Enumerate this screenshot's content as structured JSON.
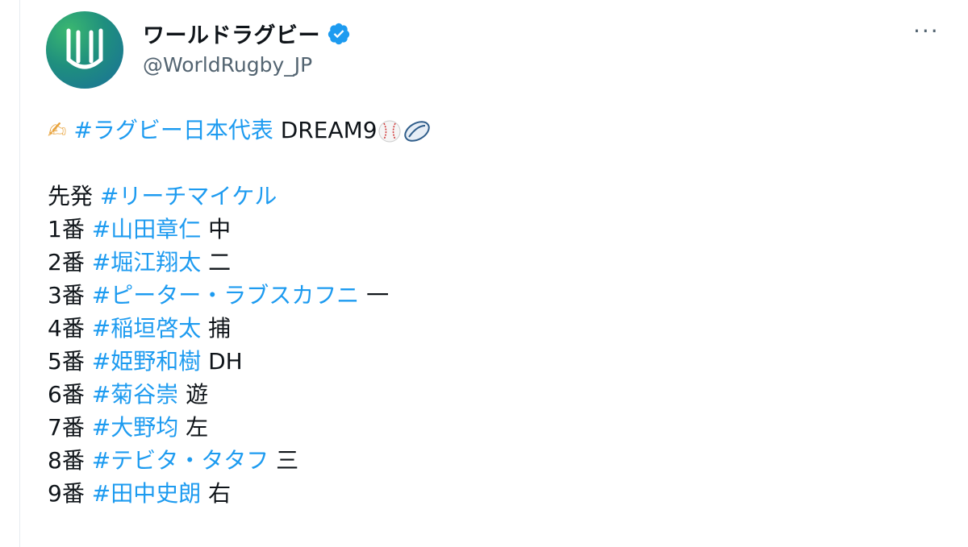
{
  "account": {
    "display_name": "ワールドラグビー",
    "handle": "@WorldRugby_JP",
    "verified_icon": "verified-badge-icon",
    "more_icon": "more-icon",
    "more_label": "···",
    "brand_color": "#1d9bf0"
  },
  "tweet": {
    "headline": {
      "pencil_emoji": "✍",
      "hashtag": "#ラグビー日本代表",
      "text": "DREAM9",
      "baseball_icon": "baseball-icon",
      "rugby_icon": "rugby-ball-icon"
    },
    "starter": {
      "label": "先発",
      "player": "#リーチマイケル"
    },
    "lineup": [
      {
        "order": "1番",
        "player": "#山田章仁",
        "position": "中"
      },
      {
        "order": "2番",
        "player": "#堀江翔太",
        "position": "二"
      },
      {
        "order": "3番",
        "player": "#ピーター・ラブスカフニ",
        "position": "一"
      },
      {
        "order": "4番",
        "player": "#稲垣啓太",
        "position": "捕"
      },
      {
        "order": "5番",
        "player": "#姫野和樹",
        "position": "DH"
      },
      {
        "order": "6番",
        "player": "#菊谷崇",
        "position": "遊"
      },
      {
        "order": "7番",
        "player": "#大野均",
        "position": "左"
      },
      {
        "order": "8番",
        "player": "#テビタ・タタフ",
        "position": "三"
      },
      {
        "order": "9番",
        "player": "#田中史朗",
        "position": "右"
      }
    ]
  }
}
